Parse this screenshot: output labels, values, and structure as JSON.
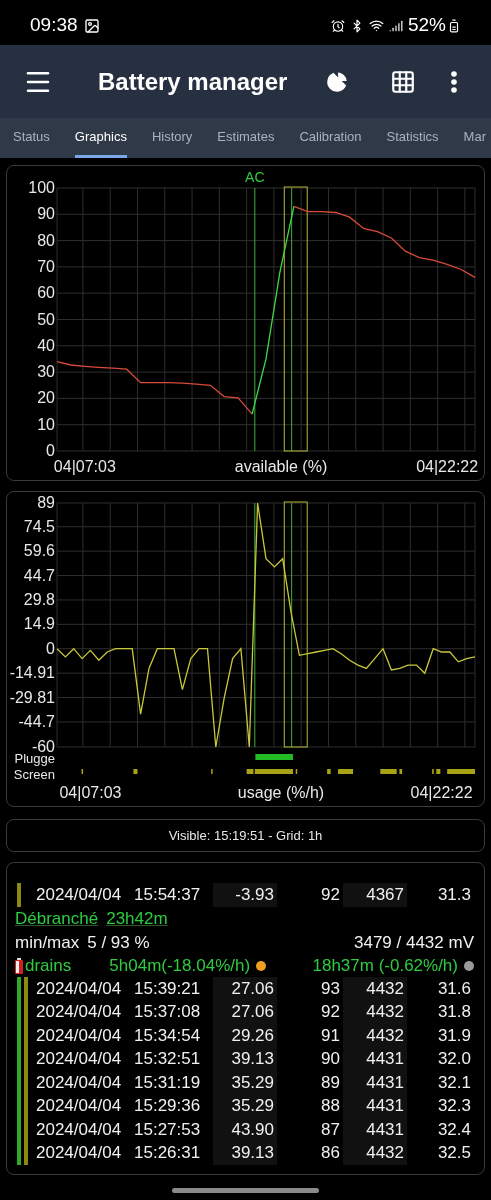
{
  "status_bar": {
    "time": "09:38",
    "battery": "52%"
  },
  "app_bar": {
    "title": "Battery manager"
  },
  "tabs": [
    {
      "label": "Status",
      "selected": false
    },
    {
      "label": "Graphics",
      "selected": true
    },
    {
      "label": "History",
      "selected": false
    },
    {
      "label": "Estimates",
      "selected": false
    },
    {
      "label": "Calibration",
      "selected": false
    },
    {
      "label": "Statistics",
      "selected": false
    },
    {
      "label": "Mar",
      "selected": false
    }
  ],
  "available_chart": {
    "plug_label": "AC",
    "chart_data": {
      "type": "line",
      "grid": true,
      "xlabel": "available (%)",
      "ylim": [
        0,
        100
      ],
      "yticks": [
        0,
        10,
        20,
        30,
        40,
        50,
        60,
        70,
        80,
        90,
        100
      ],
      "categories": [
        null,
        null,
        "04|07:03",
        null,
        null,
        null,
        null,
        null,
        null,
        null,
        null,
        null,
        null,
        null,
        null,
        null,
        null,
        null,
        null,
        null,
        null,
        null,
        null,
        null,
        null,
        null,
        null,
        null,
        "04|22:22",
        null,
        null
      ],
      "series": [
        {
          "color": "#d94a3a",
          "values": [
            34,
            32.7,
            32.2,
            31.8,
            31.5,
            31.1,
            26,
            26,
            26,
            25.8,
            25.4,
            25,
            20.7,
            20.2,
            14,
            null,
            null,
            93,
            91,
            91,
            90.7,
            88.9,
            84.6,
            83.4,
            81,
            76,
            73.5,
            72.6,
            71,
            69,
            66
          ]
        },
        {
          "color": "#3fd94a",
          "values": [
            null,
            null,
            null,
            null,
            null,
            null,
            null,
            null,
            null,
            null,
            null,
            null,
            null,
            null,
            14,
            35,
            68,
            93,
            null,
            null,
            null,
            null,
            null,
            null,
            null,
            null,
            null,
            null,
            null,
            null,
            null
          ]
        }
      ]
    }
  },
  "usage_chart": {
    "chart_data": {
      "type": "line",
      "grid": true,
      "xlabel": "usage (%/h)",
      "ylim": [
        -60,
        89
      ],
      "yticks": [
        89,
        74.5,
        59.6,
        44.7,
        29.8,
        14.9,
        0,
        -14.91,
        -29.81,
        -44.7,
        -60
      ],
      "categories": [
        null,
        null,
        null,
        null,
        "04|07:03",
        null,
        null,
        null,
        null,
        null,
        null,
        null,
        null,
        null,
        null,
        null,
        null,
        null,
        null,
        null,
        null,
        null,
        null,
        null,
        null,
        null,
        null,
        null,
        null,
        null,
        null,
        null,
        null,
        null,
        null,
        null,
        null,
        null,
        null,
        null,
        null,
        null,
        null,
        null,
        null,
        null,
        "04|22:22",
        null,
        null,
        null,
        null
      ],
      "series": [
        {
          "color": "#c8c83a",
          "values": [
            0,
            -5,
            0,
            -6,
            -1,
            -7,
            -2,
            0,
            0,
            0,
            -40,
            -12,
            0,
            0,
            0,
            -25,
            -6,
            0,
            0,
            -60,
            -30,
            -6,
            0,
            -60,
            89,
            55,
            50,
            55,
            22,
            -4,
            -3,
            -2,
            -1,
            0,
            -3,
            -7,
            -10,
            -12,
            -6,
            0,
            -13,
            -12,
            -10,
            -10,
            -15,
            0,
            -2,
            -2,
            -8,
            -6,
            -5
          ]
        }
      ]
    },
    "tracks": [
      {
        "label": "Plugge"
      },
      {
        "label": "Screen"
      }
    ]
  },
  "visible_bar": "Visible: 15:19:51 - Grid: 1h",
  "history": {
    "before": [
      {
        "date": "2024/04/04",
        "time": "15:54:37",
        "rate": "-3.93",
        "percent": "92",
        "voltage": "4367",
        "temp": "31.3",
        "bars": [
          {
            "color": "#8c8a10"
          }
        ]
      }
    ],
    "event": {
      "label": "Débranché",
      "duration": "23h42m"
    },
    "minmax": {
      "label": "min/max",
      "percent": "5 / 93 %",
      "voltage": "3479 / 4432 mV"
    },
    "drains": {
      "label": "drains",
      "screen_on": "5h04m(-18.04%/h)",
      "screen_off": "18h37m (-0.62%/h)"
    },
    "rows": [
      {
        "date": "2024/04/04",
        "time": "15:39:21",
        "rate": "27.06",
        "percent": "93",
        "voltage": "4432",
        "temp": "31.6",
        "bars": [
          {
            "color": "#2eaa2e"
          },
          {
            "color": "#8c8a10"
          }
        ]
      },
      {
        "date": "2024/04/04",
        "time": "15:37:08",
        "rate": "27.06",
        "percent": "92",
        "voltage": "4432",
        "temp": "31.8",
        "bars": [
          {
            "color": "#2eaa2e"
          },
          {
            "color": "#8c8a10"
          }
        ]
      },
      {
        "date": "2024/04/04",
        "time": "15:34:54",
        "rate": "29.26",
        "percent": "91",
        "voltage": "4432",
        "temp": "31.9",
        "bars": [
          {
            "color": "#2eaa2e"
          },
          {
            "color": "#8c8a10"
          }
        ]
      },
      {
        "date": "2024/04/04",
        "time": "15:32:51",
        "rate": "39.13",
        "percent": "90",
        "voltage": "4431",
        "temp": "32.0",
        "bars": [
          {
            "color": "#2eaa2e"
          },
          {
            "color": "#8c8a10"
          }
        ]
      },
      {
        "date": "2024/04/04",
        "time": "15:31:19",
        "rate": "35.29",
        "percent": "89",
        "voltage": "4431",
        "temp": "32.1",
        "bars": [
          {
            "color": "#2eaa2e"
          },
          {
            "color": "#8c8a10"
          }
        ]
      },
      {
        "date": "2024/04/04",
        "time": "15:29:36",
        "rate": "35.29",
        "percent": "88",
        "voltage": "4431",
        "temp": "32.3",
        "bars": [
          {
            "color": "#2eaa2e"
          },
          {
            "color": "#8c8a10"
          }
        ]
      },
      {
        "date": "2024/04/04",
        "time": "15:27:53",
        "rate": "43.90",
        "percent": "87",
        "voltage": "4431",
        "temp": "32.4",
        "bars": [
          {
            "color": "#2eaa2e"
          },
          {
            "color": "#8c8a10"
          }
        ]
      },
      {
        "date": "2024/04/04",
        "time": "15:26:31",
        "rate": "39.13",
        "percent": "86",
        "voltage": "4432",
        "temp": "32.5",
        "bars": [
          {
            "color": "#2eaa2e"
          },
          {
            "color": "#8c8a10"
          }
        ]
      }
    ]
  }
}
